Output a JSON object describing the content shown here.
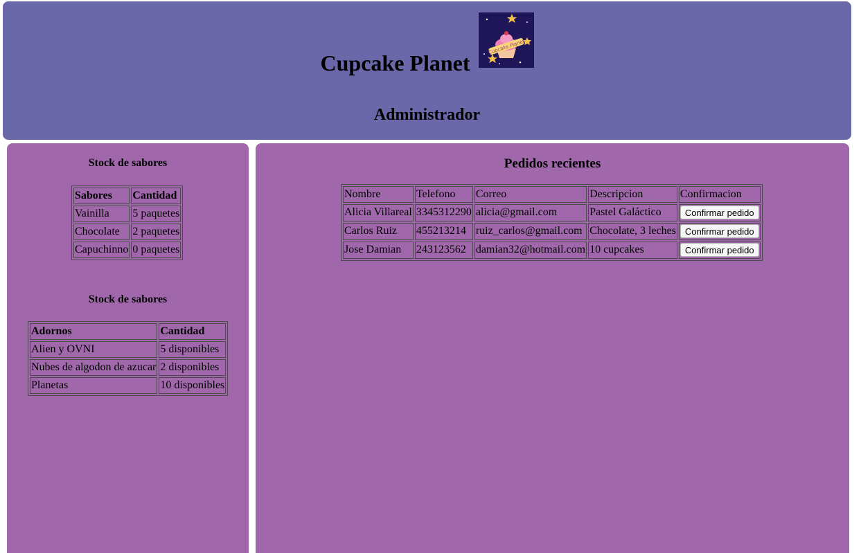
{
  "header": {
    "title": "Cupcake Planet",
    "subtitle": "Administrador",
    "background": "#6a68a9",
    "logo_icon": "cupcake-planet-logo",
    "logo_text": "Cupcake Planet"
  },
  "left": {
    "background": "#a068ab",
    "flavors": {
      "title": "Stock de sabores",
      "headers": [
        "Sabores",
        "Cantidad"
      ],
      "rows": [
        [
          "Vainilla",
          "5 paquetes"
        ],
        [
          "Chocolate",
          "2 paquetes"
        ],
        [
          "Capuchinno",
          "0 paquetes"
        ]
      ]
    },
    "toppings": {
      "title": "Stock de sabores",
      "headers": [
        "Adornos",
        "Cantidad"
      ],
      "rows": [
        [
          "Alien y OVNI",
          "5 disponibles"
        ],
        [
          "Nubes de algodon de azucar",
          "2 disponibles"
        ],
        [
          "Planetas",
          "10 disponibles"
        ]
      ]
    }
  },
  "orders": {
    "title": "Pedidos recientes",
    "headers": [
      "Nombre",
      "Telefono",
      "Correo",
      "Descripcion",
      "Confirmacion"
    ],
    "button_label": "Confirmar pedido",
    "rows": [
      [
        "Alicia Villareal",
        "3345312290",
        "alicia@gmail.com",
        "Pastel Galáctico"
      ],
      [
        "Carlos Ruiz",
        "455213214",
        "ruiz_carlos@gmail.com",
        "Chocolate, 3 leches"
      ],
      [
        "Jose Damian",
        "243123562",
        "damian32@hotmail.com",
        "10 cupcakes"
      ]
    ]
  }
}
